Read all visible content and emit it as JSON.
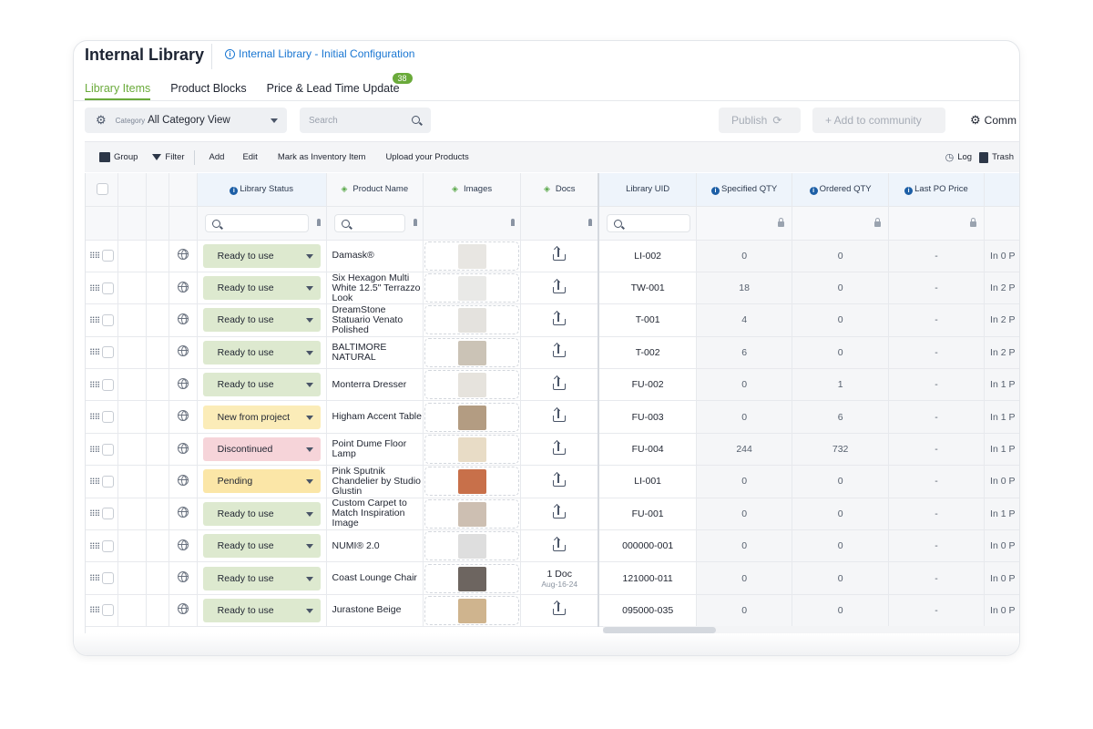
{
  "header": {
    "title": "Internal Library",
    "config_link": "Internal Library - Initial Configuration"
  },
  "tabs": [
    {
      "label": "Library Items",
      "active": true
    },
    {
      "label": "Product Blocks",
      "active": false
    },
    {
      "label": "Price & Lead Time Update",
      "active": false,
      "badge": "38"
    }
  ],
  "controls": {
    "category_prefix": "Category",
    "category_value": "All Category View",
    "search_placeholder": "Search",
    "publish_label": "Publish",
    "add_community_label": "+ Add to community",
    "community_label": "Comm"
  },
  "toolbar": {
    "group": "Group",
    "filter": "Filter",
    "add": "Add",
    "edit": "Edit",
    "mark_inventory": "Mark as Inventory Item",
    "upload": "Upload your Products",
    "log": "Log",
    "trash": "Trash"
  },
  "columns": {
    "library_status": "Library Status",
    "product_name": "Product Name",
    "images": "Images",
    "docs": "Docs",
    "library_uid": "Library UID",
    "specified_qty": "Specified QTY",
    "ordered_qty": "Ordered QTY",
    "last_po_price": "Last PO Price"
  },
  "colors": {
    "accent": "#6aaa3a",
    "link": "#1976d2",
    "status_ready": "#dde9cf",
    "status_new": "#fbecb8",
    "status_discontinued": "#f6d4d9",
    "status_pending": "#fbe6a7"
  },
  "rows": [
    {
      "status": "Ready to use",
      "status_color": "#dde9cf",
      "name": "Damask®",
      "thumb_color": "#e8e6e2",
      "doc": "upload",
      "uid": "LI-002",
      "specified": "0",
      "ordered": "0",
      "last_po": "-",
      "extra": "In 0 P"
    },
    {
      "status": "Ready to use",
      "status_color": "#dde9cf",
      "name": "Six Hexagon Multi White 12.5\" Terrazzo Look",
      "thumb_color": "#e9e9e7",
      "doc": "upload",
      "uid": "TW-001",
      "specified": "18",
      "ordered": "0",
      "last_po": "-",
      "extra": "In 2 P"
    },
    {
      "status": "Ready to use",
      "status_color": "#dde9cf",
      "name": "DreamStone Statuario Venato Polished",
      "thumb_color": "#e4e2de",
      "doc": "upload",
      "uid": "T-001",
      "specified": "4",
      "ordered": "0",
      "last_po": "-",
      "extra": "In 2 P"
    },
    {
      "status": "Ready to use",
      "status_color": "#dde9cf",
      "name": "BALTIMORE NATURAL",
      "thumb_color": "#cbc3b6",
      "doc": "upload",
      "uid": "T-002",
      "specified": "6",
      "ordered": "0",
      "last_po": "-",
      "extra": "In 2 P"
    },
    {
      "status": "Ready to use",
      "status_color": "#dde9cf",
      "name": "Monterra Dresser",
      "thumb_color": "#e6e3dd",
      "doc": "upload",
      "uid": "FU-002",
      "specified": "0",
      "ordered": "1",
      "last_po": "-",
      "extra": "In 1 P"
    },
    {
      "status": "New from project",
      "status_color": "#fbecb8",
      "name": "Higham Accent Table",
      "thumb_color": "#b39c82",
      "doc": "upload",
      "uid": "FU-003",
      "specified": "0",
      "ordered": "6",
      "last_po": "-",
      "extra": "In 1 P"
    },
    {
      "status": "Discontinued",
      "status_color": "#f6d4d9",
      "name": "Point Dume Floor Lamp",
      "thumb_color": "#e8dcc6",
      "doc": "upload",
      "uid": "FU-004",
      "specified": "244",
      "ordered": "732",
      "last_po": "-",
      "extra": "In 1 P"
    },
    {
      "status": "Pending",
      "status_color": "#fbe6a7",
      "name": "Pink Sputnik Chandelier by Studio Glustin",
      "thumb_color": "#c8704a",
      "doc": "upload",
      "uid": "LI-001",
      "specified": "0",
      "ordered": "0",
      "last_po": "-",
      "extra": "In 0 P"
    },
    {
      "status": "Ready to use",
      "status_color": "#dde9cf",
      "name": "Custom Carpet to Match Inspiration Image",
      "thumb_color": "#cdbfb2",
      "doc": "upload",
      "uid": "FU-001",
      "specified": "0",
      "ordered": "0",
      "last_po": "-",
      "extra": "In 1 P"
    },
    {
      "status": "Ready to use",
      "status_color": "#dde9cf",
      "name": "NUMI® 2.0",
      "thumb_color": "#dedede",
      "doc": "upload",
      "uid": "000000-001",
      "specified": "0",
      "ordered": "0",
      "last_po": "-",
      "extra": "In 0 P"
    },
    {
      "status": "Ready to use",
      "status_color": "#dde9cf",
      "name": "Coast Lounge Chair",
      "thumb_color": "#6d6560",
      "doc": "1 Doc",
      "doc_date": "Aug-16-24",
      "uid": "121000-011",
      "specified": "0",
      "ordered": "0",
      "last_po": "-",
      "extra": "In 0 P"
    },
    {
      "status": "Ready to use",
      "status_color": "#dde9cf",
      "name": "Jurastone Beige",
      "thumb_color": "#cfb48e",
      "doc": "upload",
      "uid": "095000-035",
      "specified": "0",
      "ordered": "0",
      "last_po": "-",
      "extra": "In 0 P"
    }
  ]
}
